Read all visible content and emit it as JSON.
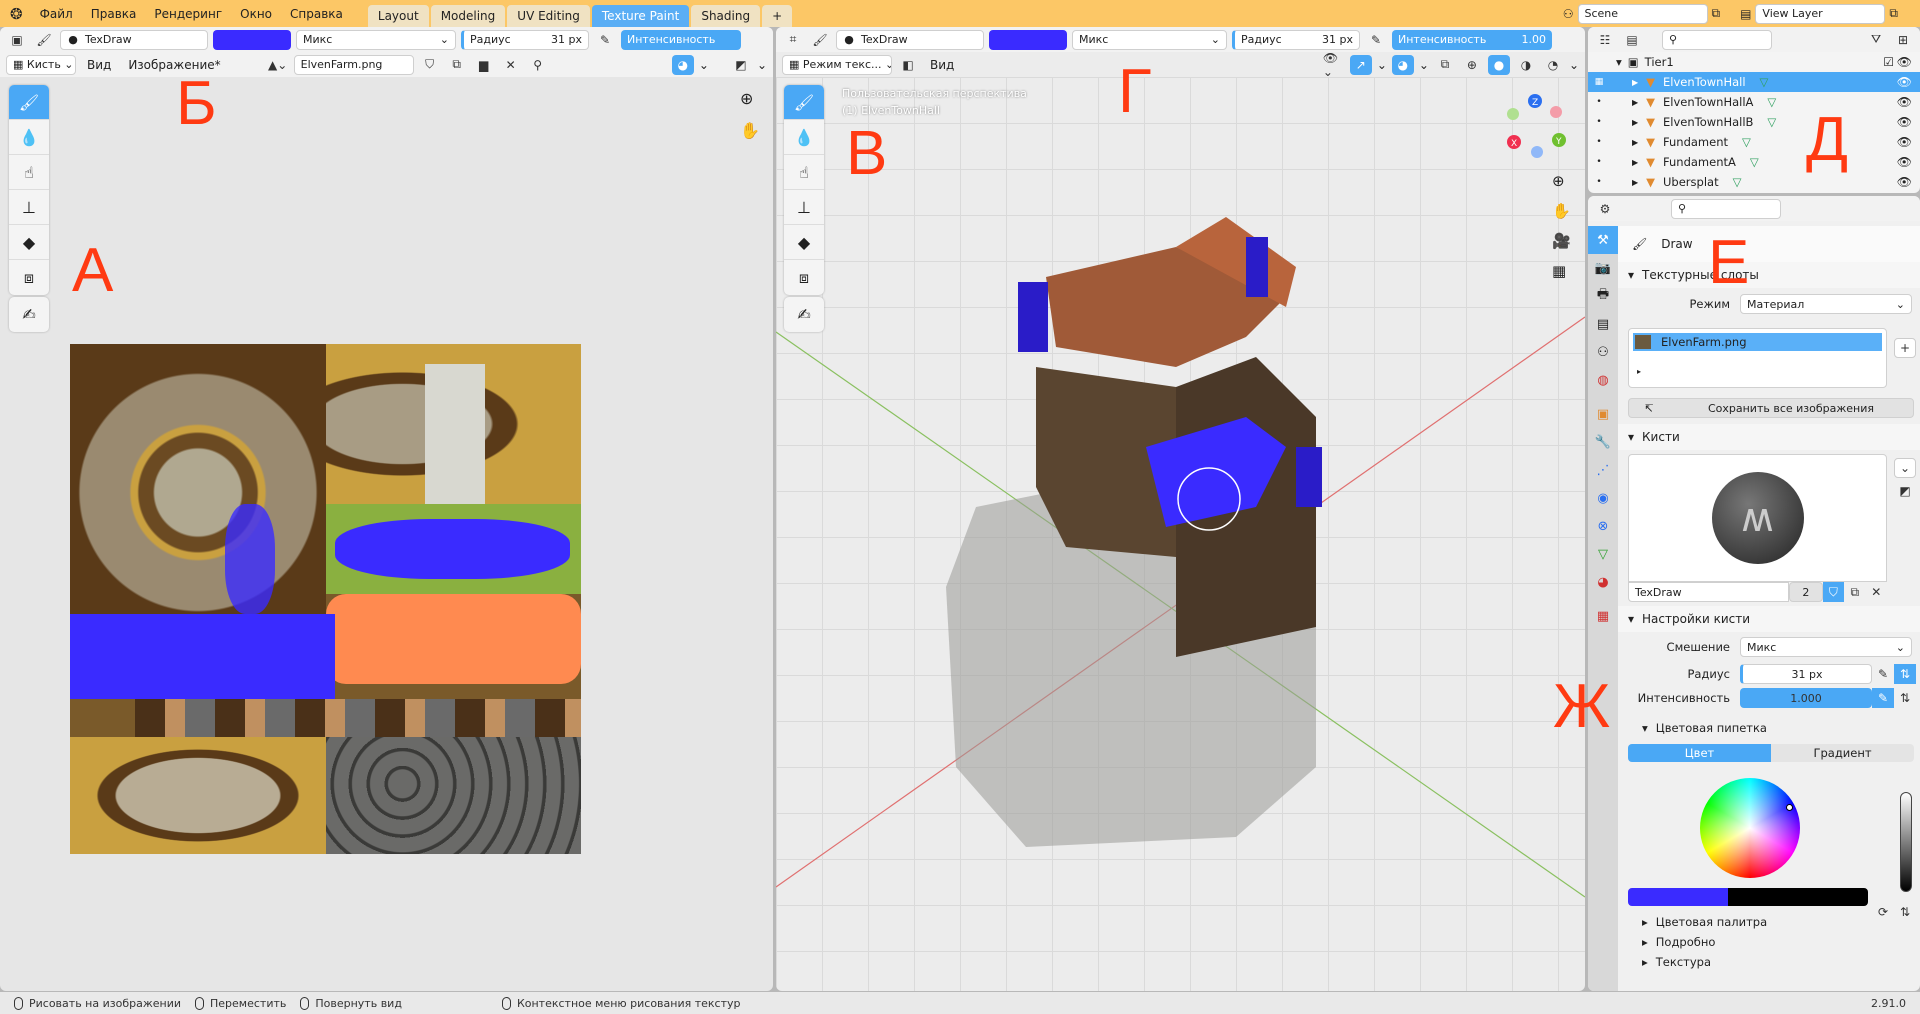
{
  "menu": [
    "Файл",
    "Правка",
    "Рендеринг",
    "Окно",
    "Справка"
  ],
  "workspaces": [
    "Layout",
    "Modeling",
    "UV Editing",
    "Texture Paint",
    "Shading",
    "+"
  ],
  "active_workspace": "Texture Paint",
  "scene": "Scene",
  "view_layer": "View Layer",
  "image_editor": {
    "brush": "TexDraw",
    "color": "#3a2bff",
    "blend": "Микс",
    "radius_label": "Радиус",
    "radius": "31 px",
    "strength_label": "Интенсивность",
    "mode": "Кисть",
    "view": "Вид",
    "image_menu": "Изображение*",
    "image_name": "ElvenFarm.png"
  },
  "viewport": {
    "brush": "TexDraw",
    "color": "#3a2bff",
    "blend": "Микс",
    "radius_label": "Радиус",
    "radius": "31 px",
    "strength_label": "Интенсивность",
    "strength": "1.00",
    "mode": "Режим текс...",
    "view": "Вид",
    "overlay_line1": "Пользовательская перспектива",
    "overlay_line2": "(1) ElvenTownHall",
    "axes": [
      "X",
      "Y",
      "Z"
    ]
  },
  "labels": {
    "a": "А",
    "b": "Б",
    "v": "В",
    "g": "Г",
    "d": "Д",
    "e": "Е",
    "zh": "Ж"
  },
  "outliner": {
    "collection": "Tier1",
    "items": [
      "ElvenTownHall",
      "ElvenTownHallA",
      "ElvenTownHallB",
      "Fundament",
      "FundamentA",
      "Ubersplat"
    ],
    "selected": 0
  },
  "properties": {
    "tool": "Draw",
    "texture_slots": "Текстурные слоты",
    "mode_label": "Режим",
    "mode": "Материал",
    "slot": "ElvenFarm.png",
    "save_all": "Сохранить все изображения",
    "brushes": "Кисти",
    "brush_name": "TexDraw",
    "brush_users": "2",
    "brush_settings": "Настройки кисти",
    "blend_label": "Смешение",
    "blend": "Микс",
    "radius_label": "Радиус",
    "radius": "31 px",
    "strength_label": "Интенсивность",
    "strength": "1.000",
    "strength_value": 1.0,
    "color_picker": "Цветовая пипетка",
    "tab_color": "Цвет",
    "tab_gradient": "Градиент",
    "primary_color": "#3a2bff",
    "secondary_color": "#000000",
    "palette": "Цветовая палитра",
    "advanced": "Подробно",
    "texture": "Текстура"
  },
  "status": {
    "paint": "Рисовать на изображении",
    "move": "Переместить",
    "rotate": "Повернуть вид",
    "context": "Контекстное меню рисования текстур",
    "version": "2.91.0"
  }
}
